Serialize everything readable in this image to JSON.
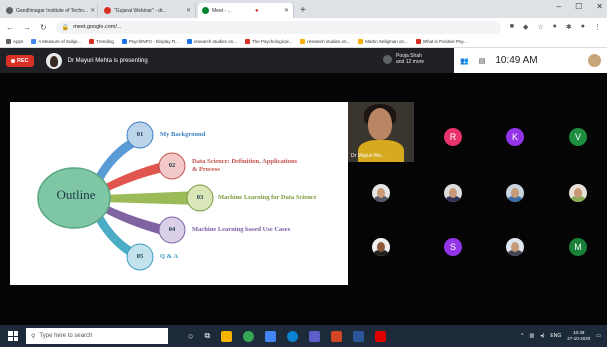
{
  "browser": {
    "tabs": [
      {
        "label": "Gandhinagar Institute of Techn...",
        "color": "#5f6368",
        "active": false
      },
      {
        "label": "\"Gujarat Webinar\" - dr...",
        "color": "#d93025",
        "active": false
      },
      {
        "label": "Meet - ...",
        "color": "#00832d",
        "active": true
      }
    ],
    "url": "meet.google.com/..."
  },
  "bookmarks": [
    {
      "label": "Apps",
      "color": "#5f6368"
    },
    {
      "label": "A Measure of Subje...",
      "color": "#4285f4"
    },
    {
      "label": "Trending",
      "color": "#d93025"
    },
    {
      "label": "PsychINFO - Display R...",
      "color": "#1a73e8"
    },
    {
      "label": "research studies on...",
      "color": "#1a73e8"
    },
    {
      "label": "The Psychological...",
      "color": "#d93025"
    },
    {
      "label": "research studies on...",
      "color": "#f9ab00"
    },
    {
      "label": "Martin Seligman on...",
      "color": "#f9ab00"
    },
    {
      "label": "What is Positive Psy...",
      "color": "#d93025"
    }
  ],
  "meet": {
    "rec_label": "REC",
    "presenting_text": "Dr Mayuri Mehta is presenting",
    "participants_text_line1": "Pooja Shah",
    "participants_text_line2": "and 12 more",
    "time": "10:49 AM"
  },
  "slide": {
    "title": "Outline",
    "items": [
      {
        "num": "01",
        "label": "My Background",
        "color": "#3a7fc1",
        "circle": "#bcd4ea"
      },
      {
        "num": "02",
        "label": "Data Science: Definition, Applications",
        "label2": "& Process",
        "color": "#c0504d",
        "circle": "#f2c9c8"
      },
      {
        "num": "03",
        "label": "Machine Learning for Data Science",
        "color": "#7a9a3a",
        "circle": "#d8e6b8"
      },
      {
        "num": "04",
        "label": "Machine Learning based Use Cases",
        "color": "#7c5fa3",
        "circle": "#d9cfe6"
      },
      {
        "num": "05",
        "label": "Q & A",
        "color": "#3a9ac1",
        "circle": "#c2e3ee"
      }
    ],
    "ribbon_colors": [
      "#5b9bd5",
      "#e0564e",
      "#9bbb59",
      "#8064a2",
      "#4bacc6"
    ],
    "hub_color": "#7fc6a4"
  },
  "participants": {
    "self_name": "Dr Mayuri Me...",
    "letters": [
      {
        "letter": "R",
        "color": "#e8336d"
      },
      {
        "letter": "K",
        "color": "#9334e6"
      },
      {
        "letter": "V",
        "color": "#1e8e3e"
      },
      {
        "letter": "S",
        "color": "#9334e6"
      },
      {
        "letter": "M",
        "color": "#188038"
      }
    ]
  },
  "taskbar": {
    "search_placeholder": "Type here to search",
    "lang": "ENG",
    "time": "10:49",
    "date": "27-10-2020"
  }
}
